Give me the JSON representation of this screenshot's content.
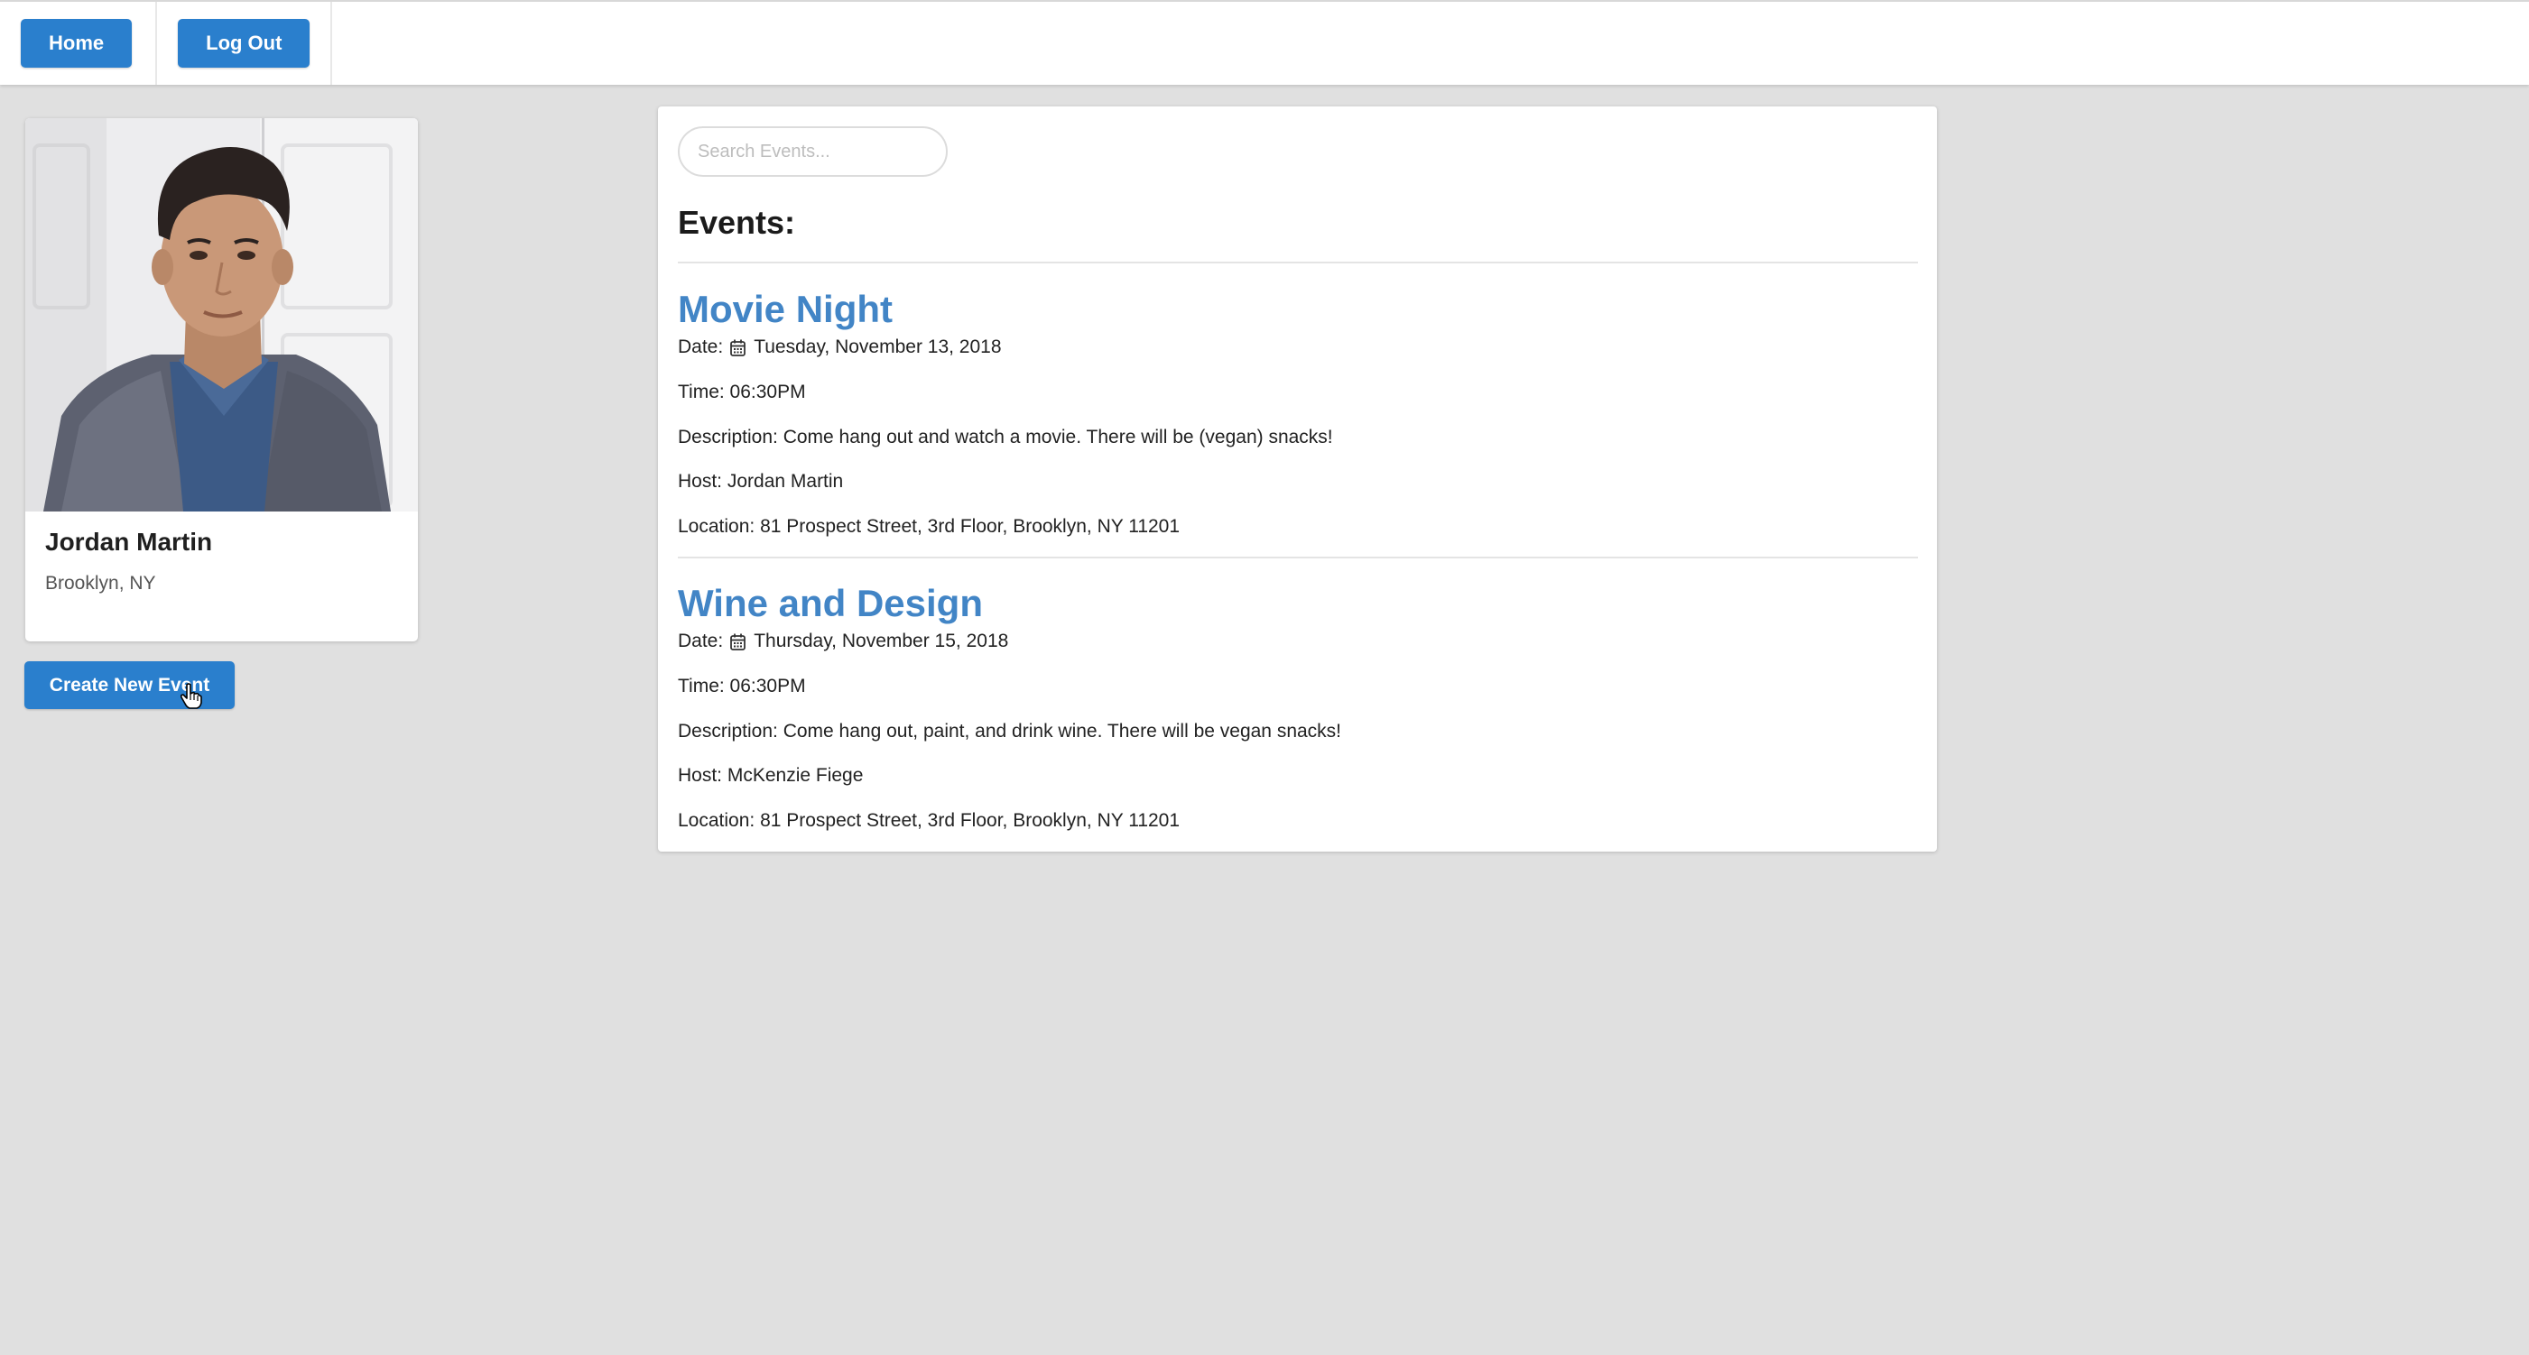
{
  "nav": {
    "home_label": "Home",
    "logout_label": "Log Out"
  },
  "profile": {
    "name": "Jordan Martin",
    "location": "Brooklyn, NY",
    "photo_icon": "profile-photo"
  },
  "actions": {
    "create_label": "Create New Event"
  },
  "search": {
    "placeholder": "Search Events...",
    "value": "",
    "icon": "search-icon"
  },
  "events_heading": "Events:",
  "events": [
    {
      "title": "Movie Night",
      "date_label": "Date:",
      "date": "Tuesday, November 13, 2018",
      "time": "Time: 06:30PM",
      "description": "Description: Come hang out and watch a movie. There will be (vegan) snacks!",
      "host": "Host: Jordan Martin",
      "location": "Location: 81 Prospect Street, 3rd Floor, Brooklyn, NY 11201"
    },
    {
      "title": "Wine and Design",
      "date_label": "Date:",
      "date": "Thursday, November 15, 2018",
      "time": "Time: 06:30PM",
      "description": "Description: Come hang out, paint, and drink wine. There will be vegan snacks!",
      "host": "Host: McKenzie Fiege",
      "location": "Location: 81 Prospect Street, 3rd Floor, Brooklyn, NY 11201"
    }
  ],
  "colors": {
    "primary_button": "#2a7fcd",
    "event_title": "#4285c6",
    "background": "#e0e0e0"
  }
}
